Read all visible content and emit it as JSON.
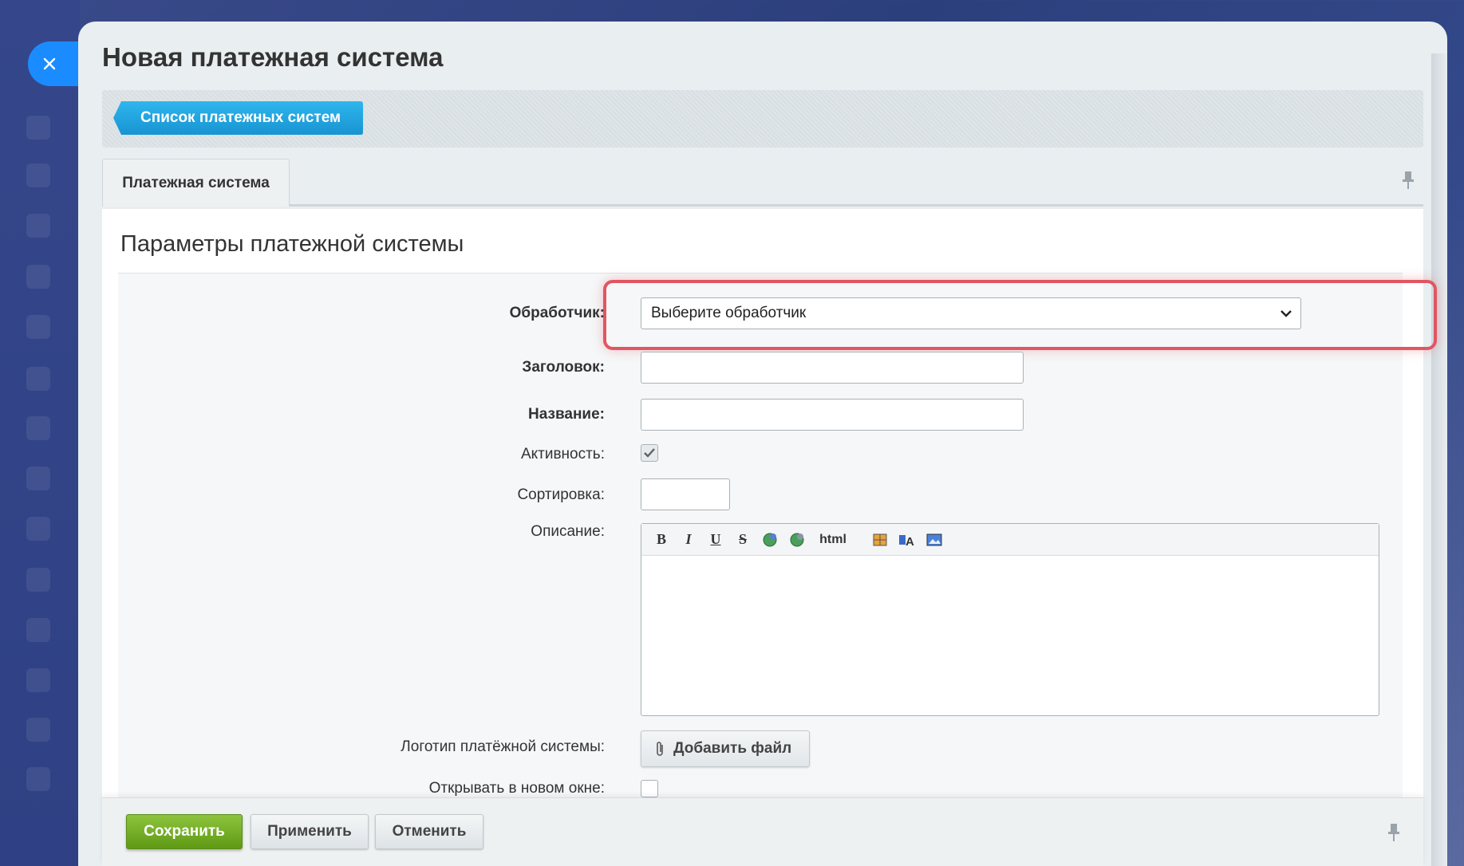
{
  "window": {
    "title": "Новая платежная система"
  },
  "toolbar": {
    "back_label": "Список платежных систем"
  },
  "tabs": [
    {
      "label": "Платежная система"
    }
  ],
  "section": {
    "title": "Параметры платежной системы"
  },
  "form": {
    "handler_label": "Обработчик:",
    "handler_value": "Выберите обработчик",
    "header_label": "Заголовок:",
    "header_value": "",
    "name_label": "Название:",
    "name_value": "",
    "active_label": "Активность:",
    "active_checked": true,
    "sort_label": "Сортировка:",
    "sort_value": "",
    "description_label": "Описание:",
    "editor_buttons": [
      "B",
      "I",
      "U",
      "S",
      "html"
    ],
    "logo_label": "Логотип платёжной системы:",
    "add_file_label": "Добавить файл",
    "new_window_label": "Открывать в новом окне:"
  },
  "footer": {
    "save_label": "Сохранить",
    "apply_label": "Применить",
    "cancel_label": "Отменить"
  },
  "colors": {
    "accent_blue": "#1a8cff",
    "save_green": "#6aa821",
    "highlight_red": "#e25562"
  }
}
